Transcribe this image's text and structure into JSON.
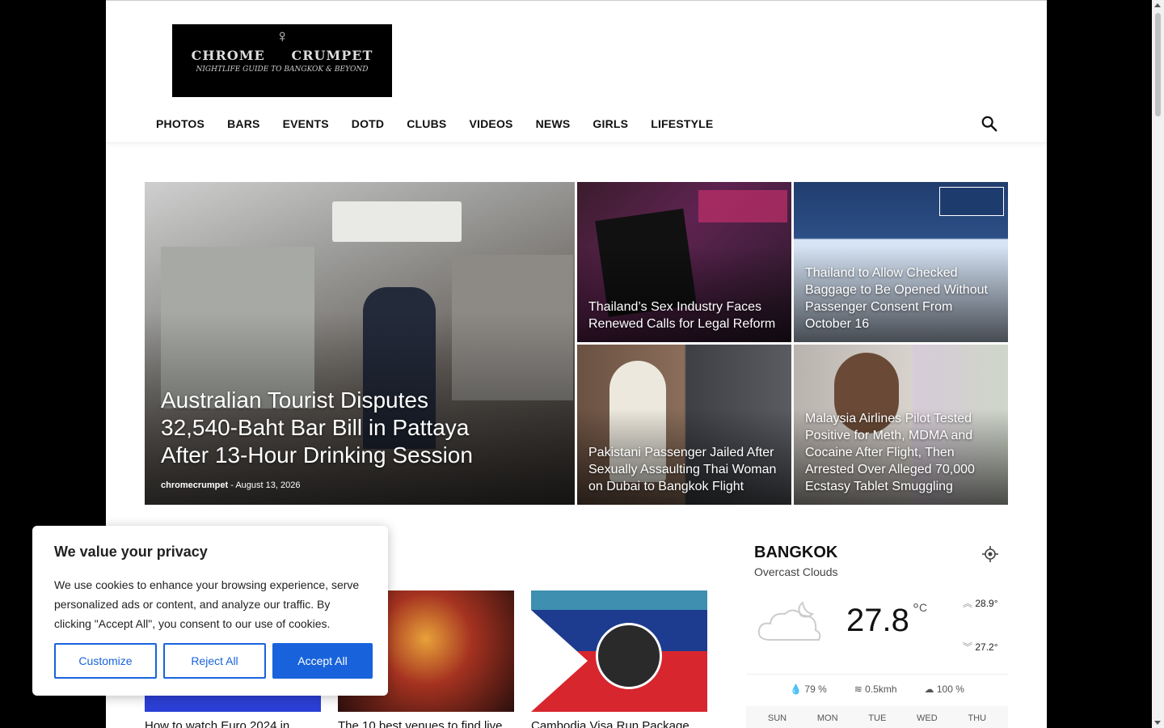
{
  "logo": {
    "brand_left": "CHROME",
    "brand_right": "CRUMPET",
    "tagline": "NIGHTLIFE GUIDE TO BANGKOK & BEYOND"
  },
  "nav": {
    "items": [
      "PHOTOS",
      "BARS",
      "EVENTS",
      "DOTD",
      "CLUBS",
      "VIDEOS",
      "NEWS",
      "GIRLS",
      "LIFESTYLE"
    ]
  },
  "featured": {
    "main": {
      "title": "Australian Tourist Disputes 32,540-Baht Bar Bill in Pattaya After 13-Hour Drinking Session",
      "author": "chromecrumpet",
      "date": "August 13, 2026"
    },
    "tile2": {
      "title": "Thailand’s Sex Industry Faces Renewed Calls for Legal Reform"
    },
    "tile3": {
      "title": "Thailand to Allow Checked Baggage to Be Opened Without Passenger Consent From October 16"
    },
    "tile4": {
      "title": "Pakistani Passenger Jailed After Sexually Assaulting Thai Woman on Dubai to Bangkok Flight"
    },
    "tile5": {
      "title": "Malaysia Airlines Pilot Tested Positive for Meth, MDMA and Cocaine After Flight, Then Arrested Over Alleged 70,000 Ecstasy Tablet Smuggling"
    }
  },
  "cards": [
    {
      "title": "How to watch Euro 2024 in"
    },
    {
      "title": "The 10 best venues to find live"
    },
    {
      "title": "Cambodia Visa Run Package"
    }
  ],
  "cookie": {
    "heading": "We value your privacy",
    "body": "We use cookies to enhance your browsing experience, serve personalized ads or content, and analyze our traffic. By clicking \"Accept All\", you consent to our use of cookies.",
    "customize": "Customize",
    "reject": "Reject All",
    "accept": "Accept All"
  },
  "weather": {
    "city": "BANGKOK",
    "desc": "Overcast Clouds",
    "temp": "27.8",
    "unit": "C",
    "high": "28.9",
    "low": "27.2",
    "humidity": "79 %",
    "wind": "0.5kmh",
    "clouds": "100 %",
    "days": [
      "SUN",
      "MON",
      "TUE",
      "WED",
      "THU"
    ]
  },
  "colors": {
    "accent": "#1863dc",
    "page_bg": "#000000"
  }
}
